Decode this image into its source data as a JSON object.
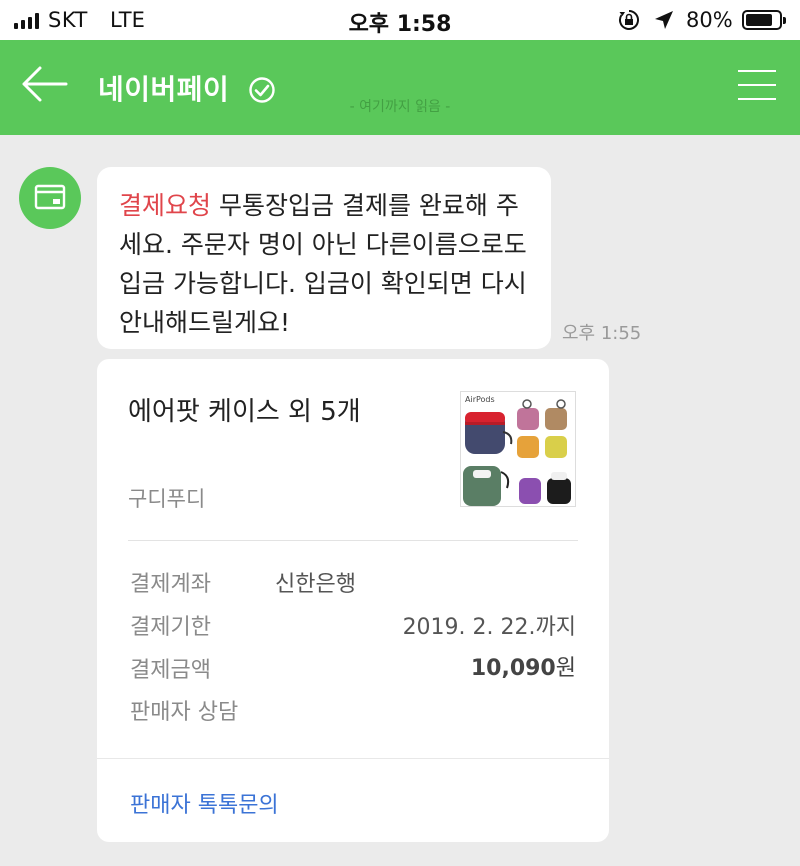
{
  "status_bar": {
    "carrier": "SKT",
    "network": "LTE",
    "time": "오후 1:58",
    "battery": "80%",
    "battery_level": 0.8
  },
  "header": {
    "title": "네이버페이",
    "read_marker": "- 여기까지 읽음 -"
  },
  "message": {
    "tag": "결제요청",
    "body": "무통장입금 결제를 완료해 주세요. 주문자 명이 아닌 다른이름으로도 입금 가능합니다. 입금이 확인되면 다시 안내해드릴게요!",
    "time": "오후 1:55"
  },
  "card": {
    "product_title": "에어팟 케이스 외 5개",
    "seller": "구디푸디",
    "thumbnail_text": "AirPods",
    "rows": {
      "account_label": "결제계좌",
      "account_value": "신한은행",
      "deadline_label": "결제기한",
      "deadline_value": "2019. 2. 22.까지",
      "amount_label": "결제금액",
      "amount_number": "10,090",
      "amount_unit": "원",
      "seller_consult_label": "판매자 상담"
    },
    "footer_link": "판매자 톡톡문의"
  },
  "colors": {
    "brand_green": "#5ac85a",
    "request_red": "#e0454b",
    "link_blue": "#3b73d6"
  },
  "icons": [
    "back-arrow-icon",
    "verified-check-icon",
    "menu-icon",
    "card-payment-icon",
    "orientation-lock-icon",
    "location-arrow-icon",
    "battery-icon",
    "signal-icon"
  ]
}
